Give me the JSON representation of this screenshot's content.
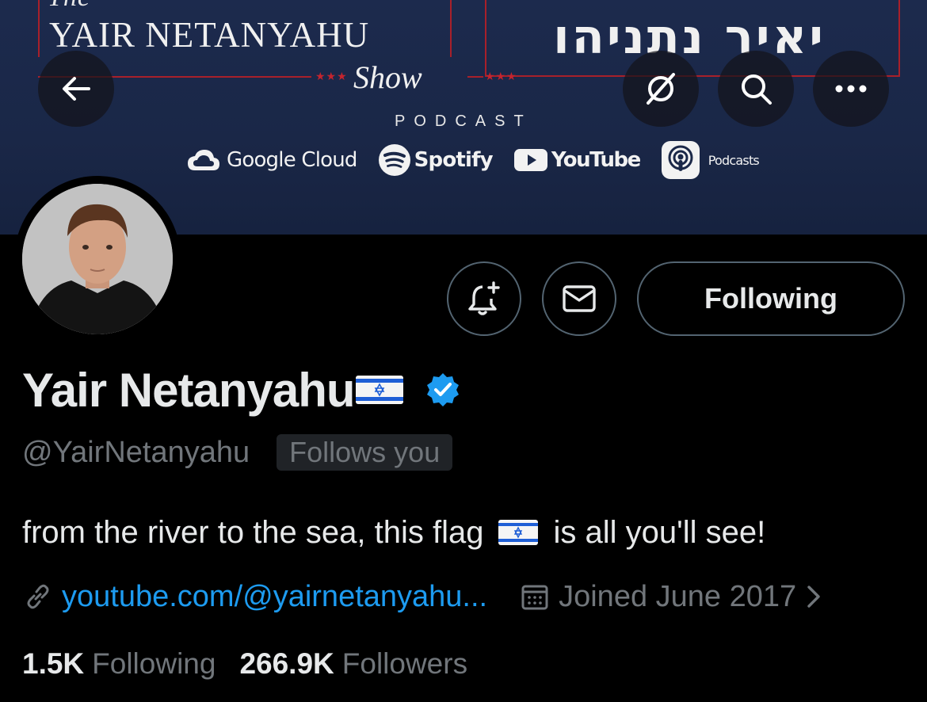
{
  "banner": {
    "show_top_cut": "The",
    "show_title": "YAIR NETANYAHU",
    "show_script": "Show",
    "hebrew_title": "יאיר נתניהו",
    "podcast_label": "PODCAST",
    "platforms": {
      "google_cloud": "Google Cloud",
      "spotify": "Spotify",
      "youtube": "YouTube",
      "apple_podcasts": "Podcasts"
    }
  },
  "nav": {
    "back_icon": "arrow-left-icon",
    "grok_icon": "grok-icon",
    "search_icon": "search-icon",
    "more_icon": "more-icon"
  },
  "actions": {
    "notify_icon": "bell-plus-icon",
    "message_icon": "envelope-icon",
    "following_label": "Following"
  },
  "profile": {
    "display_name": "Yair Netanyahu",
    "handle": "@YairNetanyahu",
    "follows_you": "Follows you",
    "bio_before_flag": "from the river to the sea, this flag",
    "bio_after_flag": "is all you'll see!",
    "link": "youtube.com/@yairnetanyahu...",
    "joined": "Joined June 2017",
    "following_count": "1.5K",
    "following_label": "Following",
    "followers_count": "266.9K",
    "followers_label": "Followers"
  },
  "colors": {
    "background": "#000000",
    "banner": "#1c2a4d",
    "accent_link": "#1d9bf0",
    "muted": "#71767b",
    "verified": "#1d9bf0",
    "banner_red": "#a8202a"
  }
}
